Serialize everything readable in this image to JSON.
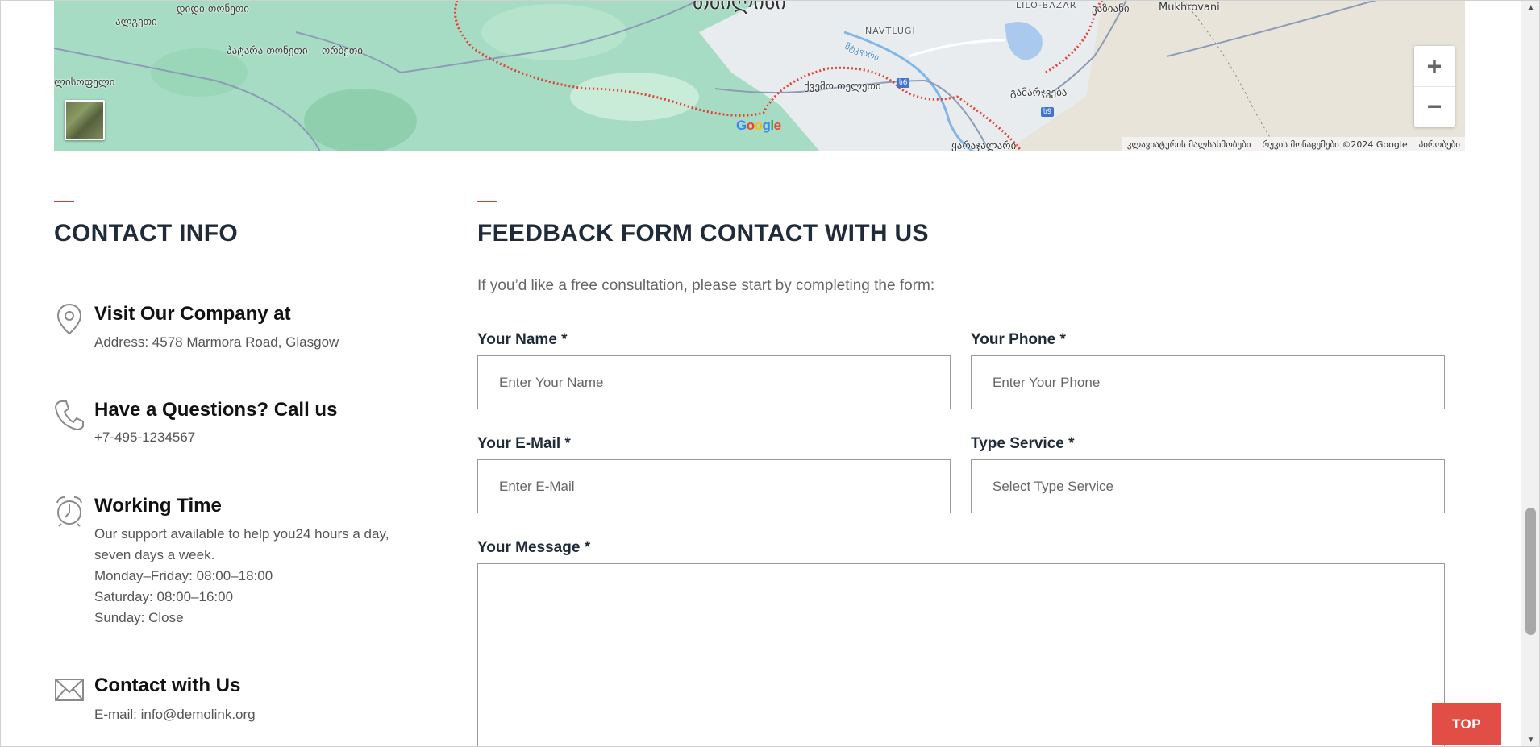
{
  "map": {
    "labels": {
      "city_partial": "თბილისი",
      "l1": "ალგეთი",
      "l2": "დიდი თონეთი",
      "l3": "პატარა თონეთი",
      "l4": "ორბეთი",
      "l5": "ლისოფელი",
      "l6": "NAVTLUGI",
      "l7": "LILO-BAZAR",
      "l8": "ვაზიანი",
      "l9": "Mukhrovani",
      "l10": "ქვემო თელეთი",
      "l11": "გამარჯვება",
      "l12": "ყარაჯალარი",
      "river": "მტკვარი",
      "shield1": "ს6",
      "shield2": "ს9"
    },
    "zoom_in_label": "+",
    "zoom_out_label": "−",
    "google_logo": "Google",
    "attribution": {
      "shortcuts": "კლავიატურის მალსახმობები",
      "map_data": "რუკის მონაცემები ©2024 Google",
      "terms": "პირობები"
    }
  },
  "contact": {
    "title": "CONTACT INFO",
    "visit": {
      "heading": "Visit Our Company at",
      "text": "Address: 4578 Marmora Road, Glasgow"
    },
    "call": {
      "heading": "Have a Questions? Call us",
      "text": "+7-495-1234567"
    },
    "time": {
      "heading": "Working Time",
      "line1": "Our support available to help you24 hours a day,",
      "line2": "seven days a week.",
      "line3": "Monday–Friday: 08:00–18:00",
      "line4": "Saturday: 08:00–16:00",
      "line5": "Sunday: Close"
    },
    "email": {
      "heading": "Contact with Us",
      "text": "E-mail: info@demolink.org"
    }
  },
  "form": {
    "title": "FEEDBACK FORM CONTACT WITH US",
    "intro": "If you’d like a free consultation, please start by completing the form:",
    "name": {
      "label": "Your Name *",
      "placeholder": "Enter Your Name"
    },
    "phone": {
      "label": "Your Phone *",
      "placeholder": "Enter Your Phone"
    },
    "email": {
      "label": "Your E-Mail *",
      "placeholder": "Enter E-Mail"
    },
    "service": {
      "label": "Type Service *",
      "placeholder": "Select Type Service"
    },
    "message": {
      "label": "Your Message *"
    }
  },
  "top_button": "TOP",
  "colors": {
    "accent": "#e53935",
    "top_button": "#e04e45",
    "heading": "#1f2b38"
  }
}
